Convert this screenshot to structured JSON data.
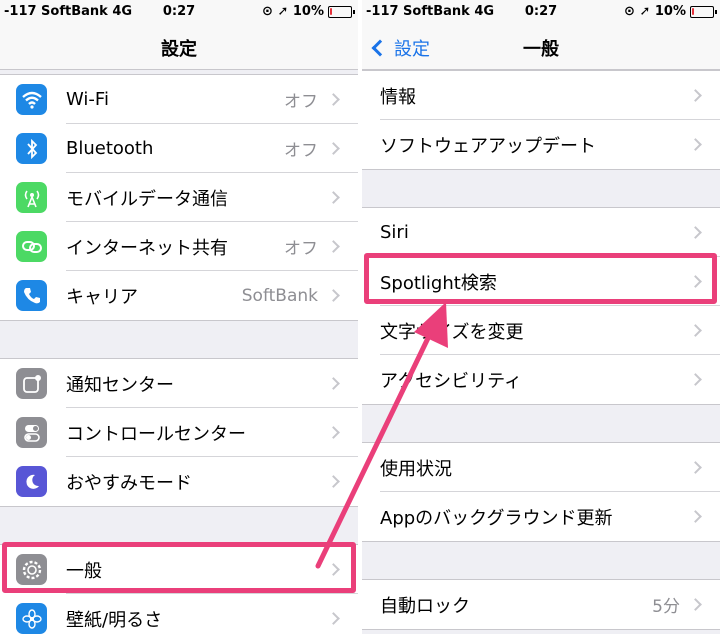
{
  "left": {
    "status": {
      "carrier": "-117 SoftBank  4G",
      "time": "0:27",
      "battery": "10%",
      "battery_level": 0.1
    },
    "title": "設定",
    "groups": [
      {
        "items": [
          {
            "label": "Wi-Fi",
            "value": "オフ",
            "icon": "wifi-icon",
            "icon_color": "#1e88e5"
          },
          {
            "label": "Bluetooth",
            "value": "オフ",
            "icon": "bluetooth-icon",
            "icon_color": "#1e88e5"
          },
          {
            "label": "モバイルデータ通信",
            "value": "",
            "icon": "antenna-icon",
            "icon_color": "#4cd964"
          },
          {
            "label": "インターネット共有",
            "value": "オフ",
            "icon": "hotspot-icon",
            "icon_color": "#4cd964"
          },
          {
            "label": "キャリア",
            "value": "SoftBank",
            "icon": "phone-icon",
            "icon_color": "#1e88e5"
          }
        ]
      },
      {
        "items": [
          {
            "label": "通知センター",
            "value": "",
            "icon": "notification-icon",
            "icon_color": "#8e8e93"
          },
          {
            "label": "コントロールセンター",
            "value": "",
            "icon": "toggles-icon",
            "icon_color": "#8e8e93"
          },
          {
            "label": "おやすみモード",
            "value": "",
            "icon": "moon-icon",
            "icon_color": "#5856d6"
          }
        ]
      },
      {
        "items": [
          {
            "label": "一般",
            "value": "",
            "icon": "gear-icon",
            "icon_color": "#8e8e93"
          },
          {
            "label": "壁紙/明るさ",
            "value": "",
            "icon": "flower-icon",
            "icon_color": "#1e88e5"
          }
        ]
      }
    ]
  },
  "right": {
    "status": {
      "carrier": "-117 SoftBank  4G",
      "time": "0:27",
      "battery": "10%",
      "battery_level": 0.1
    },
    "back_label": "設定",
    "title": "一般",
    "groups": [
      {
        "items": [
          {
            "label": "情報",
            "value": ""
          },
          {
            "label": "ソフトウェアアップデート",
            "value": ""
          }
        ]
      },
      {
        "items": [
          {
            "label": "Siri",
            "value": ""
          },
          {
            "label": "Spotlight検索",
            "value": ""
          },
          {
            "label": "文字サイズを変更",
            "value": ""
          },
          {
            "label": "アクセシビリティ",
            "value": ""
          }
        ]
      },
      {
        "items": [
          {
            "label": "使用状況",
            "value": ""
          },
          {
            "label": "Appのバックグラウンド更新",
            "value": ""
          }
        ]
      },
      {
        "items": [
          {
            "label": "自動ロック",
            "value": "5分"
          }
        ]
      }
    ]
  },
  "colors": {
    "highlight": "#ea3f7a",
    "accent": "#1a73e8"
  }
}
